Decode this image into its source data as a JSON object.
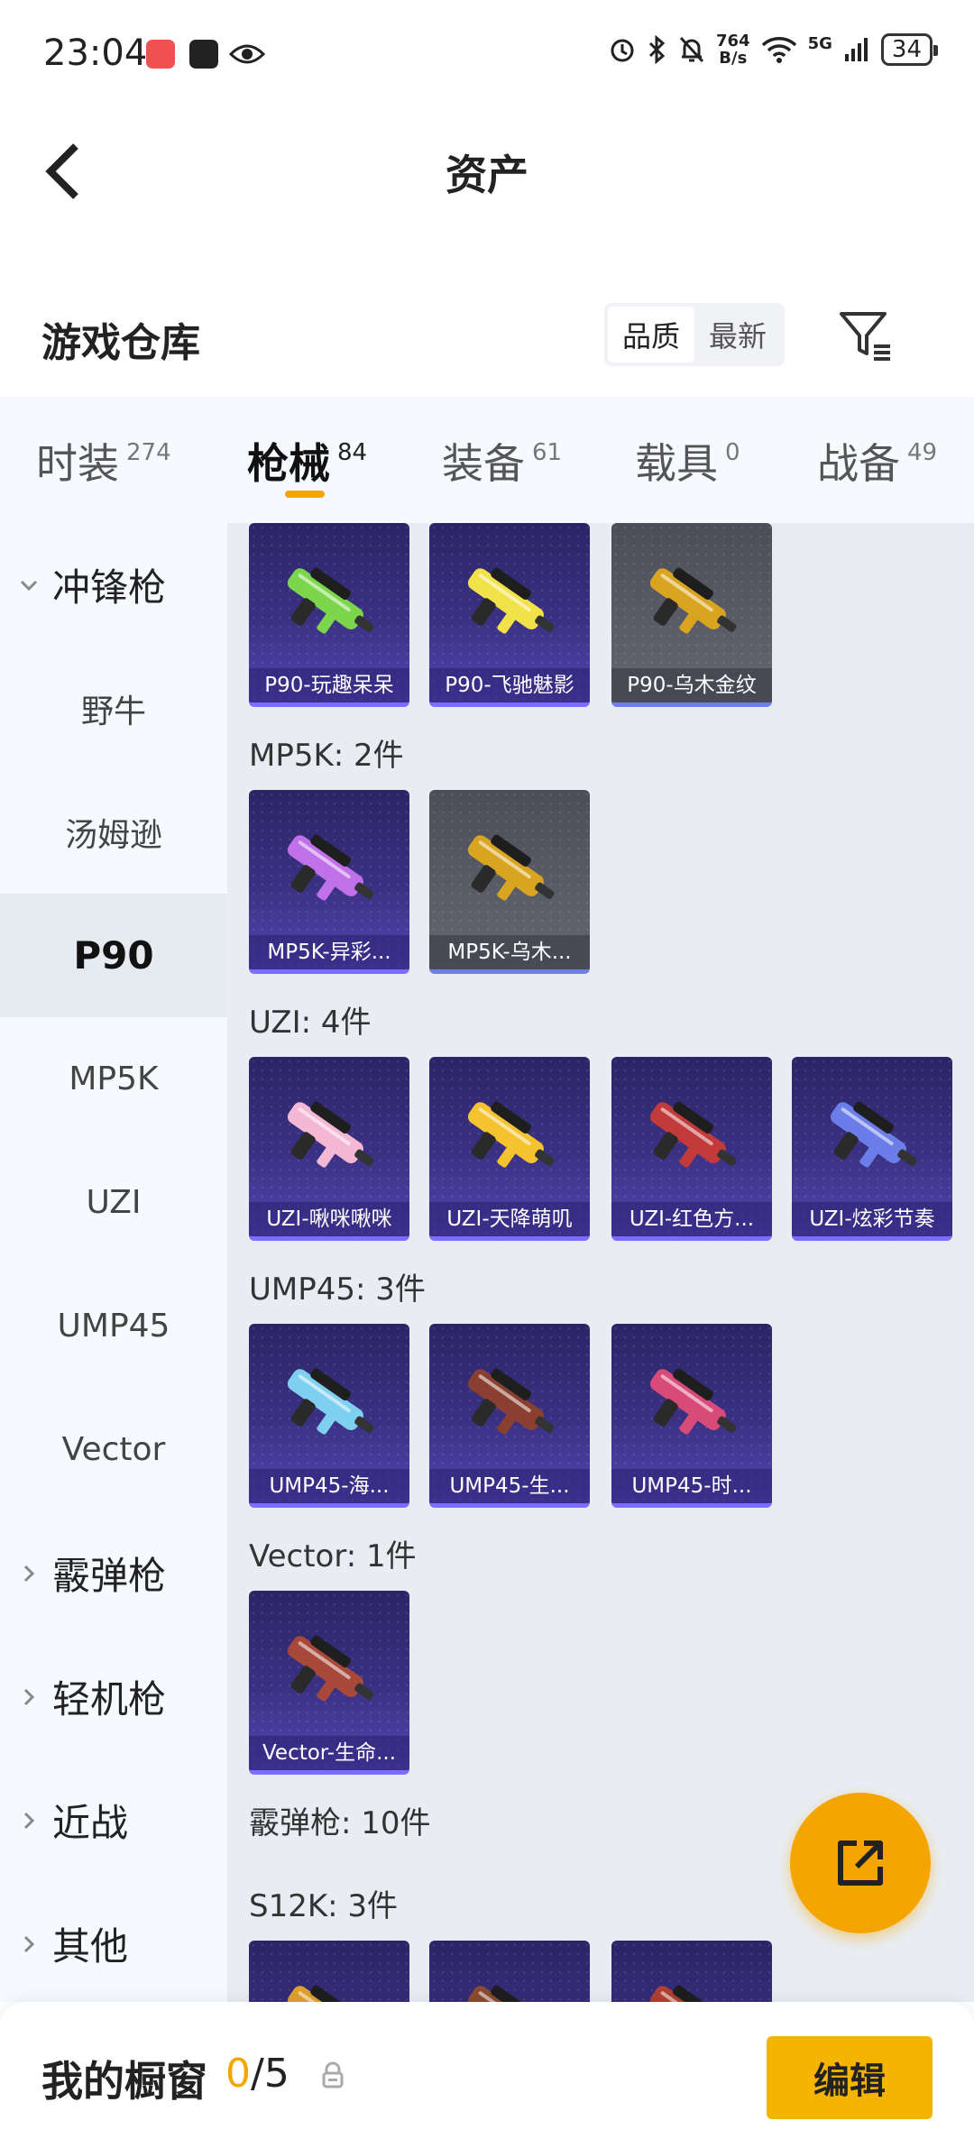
{
  "status_bar": {
    "time": "23:04",
    "net_speed_value": "764",
    "net_speed_unit": "B/s",
    "network": "5G",
    "battery": "34"
  },
  "header": {
    "title": "资产"
  },
  "warehouse": {
    "title": "游戏仓库",
    "sort_options": [
      "品质",
      "最新"
    ],
    "sort_selected": "品质"
  },
  "tabs": [
    {
      "label": "时装",
      "count": "274"
    },
    {
      "label": "枪械",
      "count": "84"
    },
    {
      "label": "装备",
      "count": "61"
    },
    {
      "label": "载具",
      "count": "0"
    },
    {
      "label": "战备",
      "count": "49"
    }
  ],
  "active_tab": "枪械",
  "sidebar": {
    "items": [
      {
        "label": "冲锋枪",
        "type": "category",
        "expanded": true
      },
      {
        "label": "野牛",
        "type": "sub"
      },
      {
        "label": "汤姆逊",
        "type": "sub"
      },
      {
        "label": "P90",
        "type": "sub",
        "active": true
      },
      {
        "label": "MP5K",
        "type": "sub"
      },
      {
        "label": "UZI",
        "type": "sub"
      },
      {
        "label": "UMP45",
        "type": "sub"
      },
      {
        "label": "Vector",
        "type": "sub"
      },
      {
        "label": "霰弹枪",
        "type": "category",
        "expanded": false
      },
      {
        "label": "轻机枪",
        "type": "category",
        "expanded": false
      },
      {
        "label": "近战",
        "type": "category",
        "expanded": false
      },
      {
        "label": "其他",
        "type": "category",
        "expanded": false
      }
    ]
  },
  "groups": [
    {
      "label": "",
      "items": [
        {
          "name": "P90-玩趣呆呆",
          "style": "purple",
          "gun_color": "#7bd64b"
        },
        {
          "name": "P90-飞驰魅影",
          "style": "purple",
          "gun_color": "#f2e24a"
        },
        {
          "name": "P90-乌木金纹",
          "style": "gray",
          "gun_color": "#d9a520"
        }
      ]
    },
    {
      "label": "MP5K: 2件",
      "items": [
        {
          "name": "MP5K-异彩...",
          "style": "purple",
          "gun_color": "#c070e8"
        },
        {
          "name": "MP5K-乌木...",
          "style": "gray",
          "gun_color": "#d9a520"
        }
      ]
    },
    {
      "label": "UZI: 4件",
      "items": [
        {
          "name": "UZI-啾咪啾咪",
          "style": "purple",
          "gun_color": "#f4b8d4"
        },
        {
          "name": "UZI-天降萌叽",
          "style": "purple",
          "gun_color": "#f5c230"
        },
        {
          "name": "UZI-红色方...",
          "style": "purple",
          "gun_color": "#c23a3a"
        },
        {
          "name": "UZI-炫彩节奏",
          "style": "purple",
          "gun_color": "#6a7de8"
        }
      ]
    },
    {
      "label": "UMP45: 3件",
      "items": [
        {
          "name": "UMP45-海...",
          "style": "purple",
          "gun_color": "#7fd0f0"
        },
        {
          "name": "UMP45-生...",
          "style": "purple",
          "gun_color": "#8a4030"
        },
        {
          "name": "UMP45-时...",
          "style": "purple",
          "gun_color": "#d84a78"
        }
      ]
    },
    {
      "label": "Vector: 1件",
      "items": [
        {
          "name": "Vector-生命...",
          "style": "purple",
          "gun_color": "#a8483a"
        }
      ]
    },
    {
      "label": "霰弹枪: 10件",
      "items": []
    },
    {
      "label": "S12K: 3件",
      "items": [
        {
          "name": "",
          "style": "purple",
          "gun_color": "#e0a030"
        },
        {
          "name": "",
          "style": "purple",
          "gun_color": "#8a4a30"
        },
        {
          "name": "",
          "style": "purple",
          "gun_color": "#b04030"
        }
      ]
    }
  ],
  "bottom_bar": {
    "title": "我的橱窗",
    "current": "0",
    "total": "/5",
    "edit_label": "编辑"
  },
  "colors": {
    "accent": "#f5a500",
    "card_purple": "#3b3184",
    "card_gray": "#5a5d68",
    "content_bg": "#e9edf3"
  }
}
